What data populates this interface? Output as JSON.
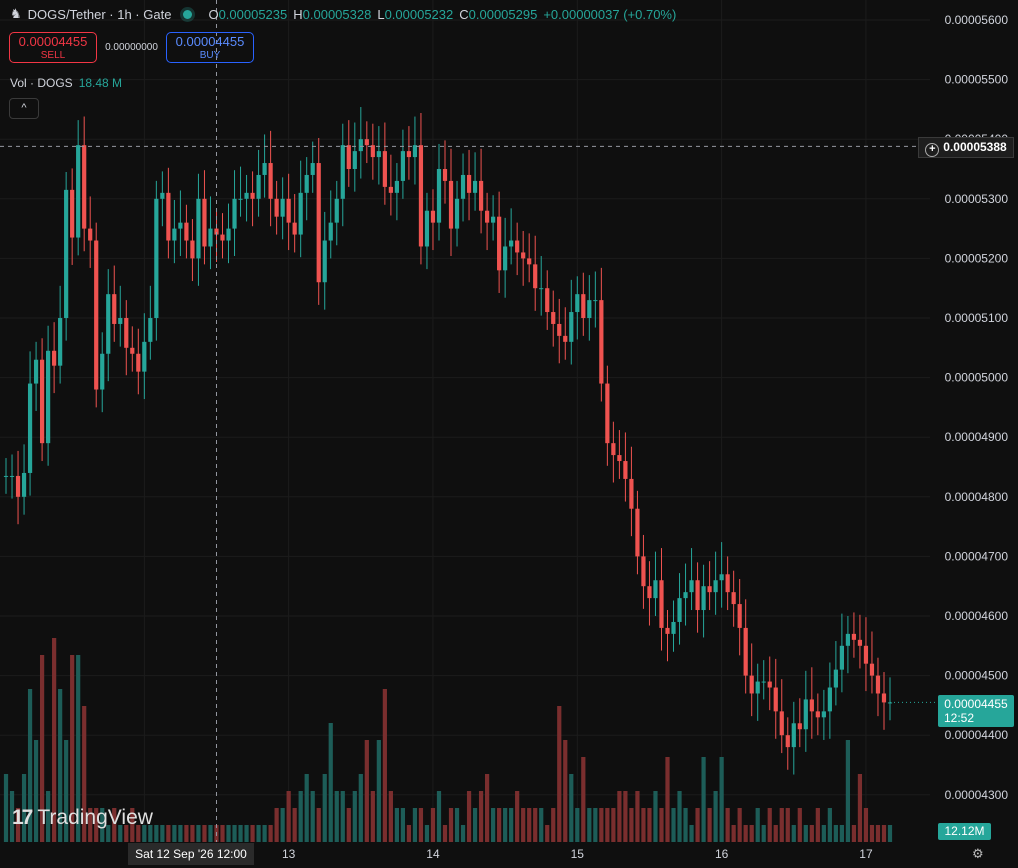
{
  "header": {
    "symbol": "DOGS/Tether · 1h · Gate",
    "logo_icon": "dogs-logo-icon",
    "ohlc": [
      {
        "key": "O",
        "value": "0.00005235"
      },
      {
        "key": "H",
        "value": "0.00005328"
      },
      {
        "key": "L",
        "value": "0.00005232"
      },
      {
        "key": "C",
        "value": "0.00005295"
      }
    ],
    "change": "+0.00000037 (+0.70%)"
  },
  "trade": {
    "sell_price": "0.00004455",
    "sell_label": "SELL",
    "spread": "0.00000000",
    "buy_price": "0.00004455",
    "buy_label": "BUY"
  },
  "volume_legend": {
    "label": "Vol · DOGS",
    "value": "18.48 M"
  },
  "collapse_label": "^",
  "branding": "TradingView",
  "crosshair": {
    "price": "0.00005388",
    "time": "Sat 12 Sep '26   12:00"
  },
  "last_price": {
    "price": "0.00004455",
    "countdown": "12:52"
  },
  "volume_tag": "12.12M",
  "colors": {
    "up": "#26a69a",
    "down": "#ef5350",
    "up_vol": "#1d5d58",
    "down_vol": "#7a2e2e",
    "background": "#0f0f0f",
    "grid": "#1c1c1c"
  },
  "chart_data": {
    "type": "candlestick",
    "price_ticks": [
      "0.00005600",
      "0.00005500",
      "0.00005400",
      "0.00005300",
      "0.00005200",
      "0.00005100",
      "0.00005000",
      "0.00004900",
      "0.00004800",
      "0.00004700",
      "0.00004600",
      "0.00004500",
      "0.00004400",
      "0.00004300"
    ],
    "price_range": [
      4.25e-05,
      5.66e-05
    ],
    "date_ticks": [
      {
        "label": "12",
        "hour": 23
      },
      {
        "label": "13",
        "hour": 47
      },
      {
        "label": "14",
        "hour": 71
      },
      {
        "label": "15",
        "hour": 95
      },
      {
        "label": "16",
        "hour": 119
      },
      {
        "label": "17",
        "hour": 143
      }
    ],
    "hours_visible": [
      -1,
      147
    ],
    "crosshair_hour": 35,
    "crosshair_price": 5.388e-05,
    "series_close": [
      4835,
      4835,
      4800,
      4840,
      4990,
      5030,
      4890,
      5045,
      5020,
      5100,
      5315,
      5235,
      5390,
      5250,
      5230,
      4980,
      5040,
      5140,
      5090,
      5100,
      5050,
      5040,
      5010,
      5060,
      5100,
      5300,
      5310,
      5230,
      5250,
      5260,
      5230,
      5200,
      5300,
      5220,
      5250,
      5240,
      5230,
      5250,
      5300,
      5300,
      5310,
      5300,
      5340,
      5360,
      5300,
      5270,
      5300,
      5260,
      5240,
      5310,
      5340,
      5360,
      5160,
      5230,
      5260,
      5300,
      5390,
      5350,
      5380,
      5400,
      5390,
      5370,
      5380,
      5320,
      5310,
      5330,
      5380,
      5370,
      5390,
      5220,
      5280,
      5260,
      5350,
      5330,
      5250,
      5300,
      5340,
      5310,
      5330,
      5280,
      5260,
      5270,
      5180,
      5220,
      5230,
      5210,
      5200,
      5190,
      5150,
      5150,
      5110,
      5090,
      5070,
      5060,
      5110,
      5140,
      5100,
      5130,
      5130,
      4990,
      4890,
      4870,
      4860,
      4830,
      4780,
      4700,
      4650,
      4630,
      4660,
      4580,
      4570,
      4590,
      4630,
      4640,
      4660,
      4610,
      4650,
      4640,
      4660,
      4670,
      4640,
      4620,
      4580,
      4500,
      4470,
      4490,
      4490,
      4480,
      4440,
      4400,
      4380,
      4420,
      4410,
      4460,
      4440,
      4430,
      4440,
      4480,
      4510,
      4550,
      4570,
      4560,
      4550,
      4520,
      4500,
      4470,
      4455,
      4455
    ],
    "series_volume": [
      0.4,
      0.3,
      0.2,
      0.4,
      0.9,
      0.6,
      1.1,
      0.3,
      1.2,
      0.9,
      0.6,
      1.1,
      1.1,
      0.8,
      0.2,
      0.2,
      0.2,
      0.1,
      0.2,
      0.1,
      0.1,
      0.2,
      0.1,
      0.1,
      0.1,
      0.1,
      0.1,
      0.1,
      0.1,
      0.1,
      0.1,
      0.1,
      0.1,
      0.1,
      0.1,
      0.1,
      0.1,
      0.1,
      0.1,
      0.1,
      0.1,
      0.1,
      0.1,
      0.1,
      0.1,
      0.2,
      0.2,
      0.3,
      0.2,
      0.3,
      0.4,
      0.3,
      0.2,
      0.4,
      0.7,
      0.3,
      0.3,
      0.2,
      0.3,
      0.4,
      0.6,
      0.3,
      0.6,
      0.9,
      0.3,
      0.2,
      0.2,
      0.1,
      0.2,
      0.2,
      0.1,
      0.2,
      0.3,
      0.1,
      0.2,
      0.2,
      0.1,
      0.3,
      0.2,
      0.3,
      0.4,
      0.2,
      0.2,
      0.2,
      0.2,
      0.3,
      0.2,
      0.2,
      0.2,
      0.2,
      0.1,
      0.2,
      0.8,
      0.6,
      0.4,
      0.2,
      0.5,
      0.2,
      0.2,
      0.2,
      0.2,
      0.2,
      0.3,
      0.3,
      0.2,
      0.3,
      0.2,
      0.2,
      0.3,
      0.2,
      0.5,
      0.2,
      0.3,
      0.2,
      0.1,
      0.2,
      0.5,
      0.2,
      0.3,
      0.5,
      0.2,
      0.1,
      0.2,
      0.1,
      0.1,
      0.2,
      0.1,
      0.2,
      0.1,
      0.2,
      0.2,
      0.1,
      0.2,
      0.1,
      0.1,
      0.2,
      0.1,
      0.2,
      0.1,
      0.1,
      0.6,
      0.1,
      0.4,
      0.2,
      0.1,
      0.1,
      0.1,
      0.1
    ]
  }
}
